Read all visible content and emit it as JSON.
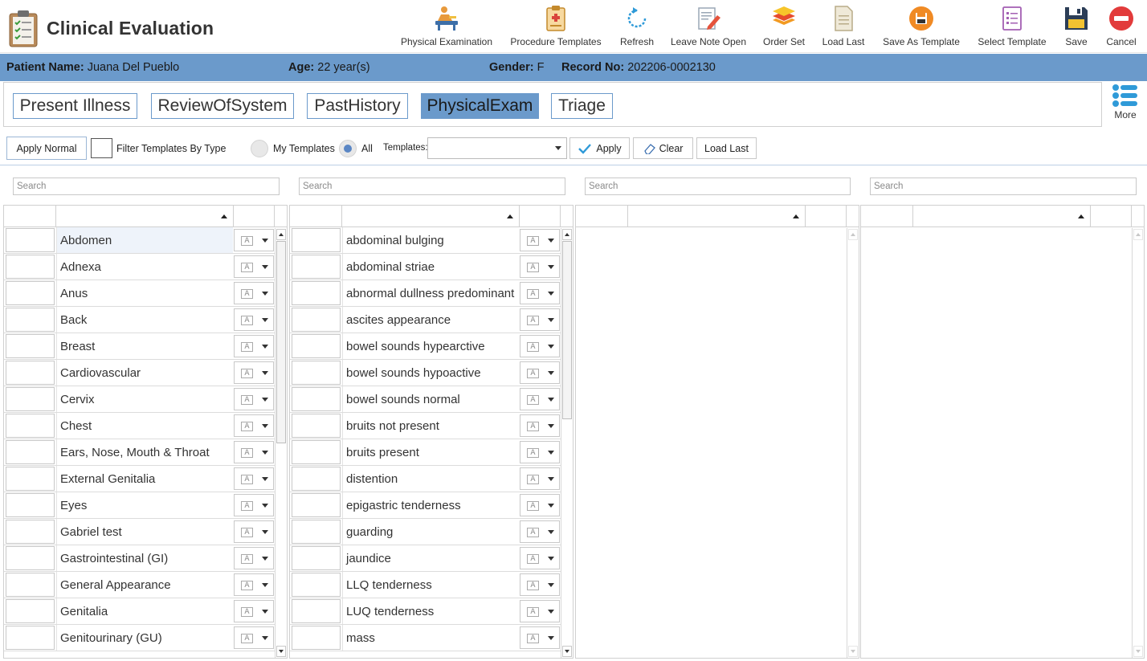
{
  "app": {
    "title": "Clinical Evaluation"
  },
  "toolbar": [
    {
      "id": "physical-examination",
      "label": "Physical Examination",
      "icon": "physical-exam-icon"
    },
    {
      "id": "procedure-templates",
      "label": "Procedure Templates",
      "icon": "clipboard-icon"
    },
    {
      "id": "refresh",
      "label": "Refresh",
      "icon": "refresh-icon"
    },
    {
      "id": "leave-note-open",
      "label": "Leave Note Open",
      "icon": "note-pencil-icon"
    },
    {
      "id": "order-set",
      "label": "Order Set",
      "icon": "layers-icon"
    },
    {
      "id": "load-last",
      "label": "Load Last",
      "icon": "document-icon"
    },
    {
      "id": "save-as-template",
      "label": "Save As Template",
      "icon": "floppy-circle-icon"
    },
    {
      "id": "select-template",
      "label": "Select Template",
      "icon": "list-document-icon"
    },
    {
      "id": "save",
      "label": "Save",
      "icon": "floppy-icon"
    },
    {
      "id": "cancel",
      "label": "Cancel",
      "icon": "cancel-circle-icon"
    }
  ],
  "patient": {
    "name_label": "Patient Name:",
    "name": "Juana Del Pueblo",
    "age_label": "Age:",
    "age": "22 year(s)",
    "gender_label": "Gender:",
    "gender": "F",
    "record_label": "Record No:",
    "record": "202206-0002130"
  },
  "tabs": [
    {
      "label": "Present Illness",
      "active": false
    },
    {
      "label": "ReviewOfSystem",
      "active": false
    },
    {
      "label": "PastHistory",
      "active": false
    },
    {
      "label": "PhysicalExam",
      "active": true
    },
    {
      "label": "Triage",
      "active": false
    }
  ],
  "more": {
    "label": "More"
  },
  "filter": {
    "apply_normal": "Apply Normal",
    "filter_by_type": "Filter Templates By Type",
    "my_templates": "My Templates",
    "all": "All",
    "templates_label": "Templates:",
    "templates_value": "",
    "apply": "Apply",
    "clear": "Clear",
    "load_last": "Load Last"
  },
  "search_placeholder": "Search",
  "lists": {
    "systems": [
      "Abdomen",
      "Adnexa",
      "Anus",
      "Back",
      "Breast",
      "Cardiovascular",
      "Cervix",
      "Chest",
      "Ears, Nose, Mouth & Throat",
      "External Genitalia",
      "Eyes",
      "Gabriel test",
      "Gastrointestinal (GI)",
      "General Appearance",
      "Genitalia",
      "Genitourinary (GU)"
    ],
    "findings": [
      "abdominal bulging",
      "abdominal striae",
      "abnormal dullness predominant",
      "ascites appearance",
      "bowel sounds hypearctive",
      "bowel sounds hypoactive",
      "bowel sounds normal",
      "bruits not present",
      "bruits present",
      "distention",
      "epigastric tenderness",
      "guarding",
      "jaundice",
      "LLQ tenderness",
      "LUQ tenderness",
      "mass"
    ]
  },
  "colors": {
    "accent": "#6b9acb",
    "border": "#c8c8c8"
  }
}
